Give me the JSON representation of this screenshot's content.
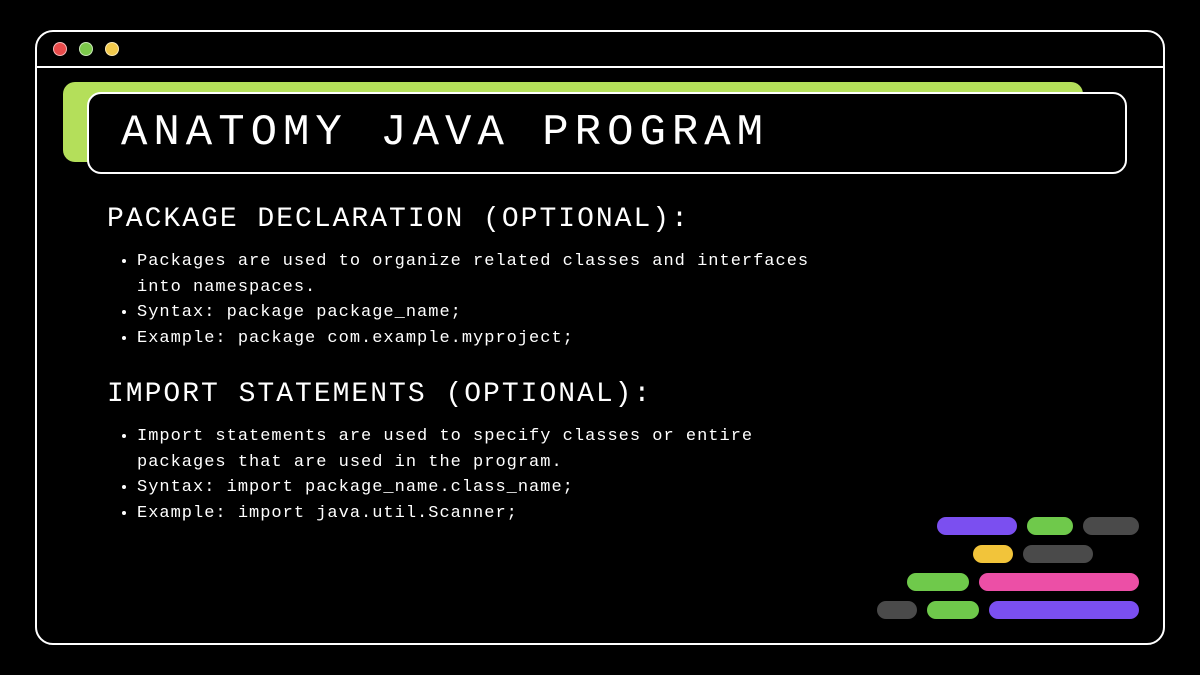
{
  "title": "ANATOMY JAVA PROGRAM",
  "sections": [
    {
      "heading": "PACKAGE DECLARATION (OPTIONAL):",
      "bullets": [
        "Packages are used to organize related classes and interfaces into namespaces.",
        "Syntax: package package_name;",
        "Example: package com.example.myproject;"
      ]
    },
    {
      "heading": "IMPORT STATEMENTS (OPTIONAL):",
      "bullets": [
        "Import statements are used to specify classes or entire packages that are used in the program.",
        "Syntax: import package_name.class_name;",
        "Example: import java.util.Scanner;"
      ]
    }
  ],
  "colors": {
    "accent_green": "#b4df5a",
    "purple": "#7b4ff0",
    "green": "#6fc94b",
    "gray": "#4a4a4a",
    "yellow": "#f2c43a",
    "pink": "#ec4fa6"
  }
}
